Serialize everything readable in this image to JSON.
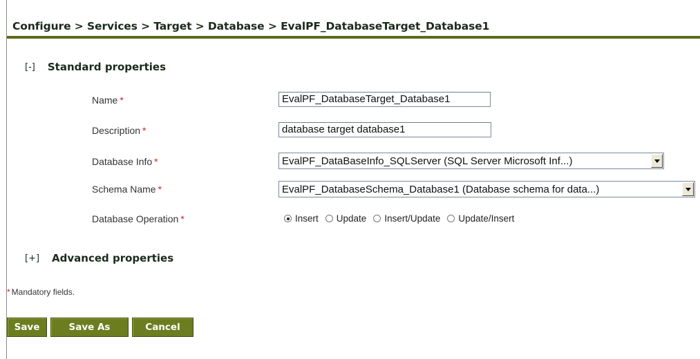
{
  "breadcrumb": {
    "text": "Configure > Services > Target > Database > EvalPF_DatabaseTarget_Database1"
  },
  "sections": {
    "standard": {
      "toggle": "[-]",
      "title": "Standard properties"
    },
    "advanced": {
      "toggle": "[+]",
      "title": "Advanced properties"
    }
  },
  "form": {
    "required_mark": "*",
    "name": {
      "label": "Name",
      "value": "EvalPF_DatabaseTarget_Database1"
    },
    "description": {
      "label": "Description",
      "value": "database target database1"
    },
    "database_info": {
      "label": "Database Info",
      "value": "EvalPF_DataBaseInfo_SQLServer (SQL Server Microsoft Inf...)"
    },
    "schema_name": {
      "label": "Schema Name",
      "value": "EvalPF_DatabaseSchema_Database1 (Database schema for data...)"
    },
    "database_operation": {
      "label": "Database Operation",
      "options": [
        "Insert",
        "Update",
        "Insert/Update",
        "Update/Insert"
      ],
      "selected": "Insert"
    }
  },
  "mandatory_note": {
    "star": "*",
    "text": "Mandatory fields."
  },
  "buttons": {
    "save": "Save",
    "save_as": "Save As",
    "cancel": "Cancel"
  },
  "colors": {
    "accent": "#6b7d1f",
    "rule": "#5a6b1a",
    "required": "#cc2222"
  },
  "icons": {
    "dropdown": "chevron-down-icon",
    "radio": "radio-icon"
  }
}
